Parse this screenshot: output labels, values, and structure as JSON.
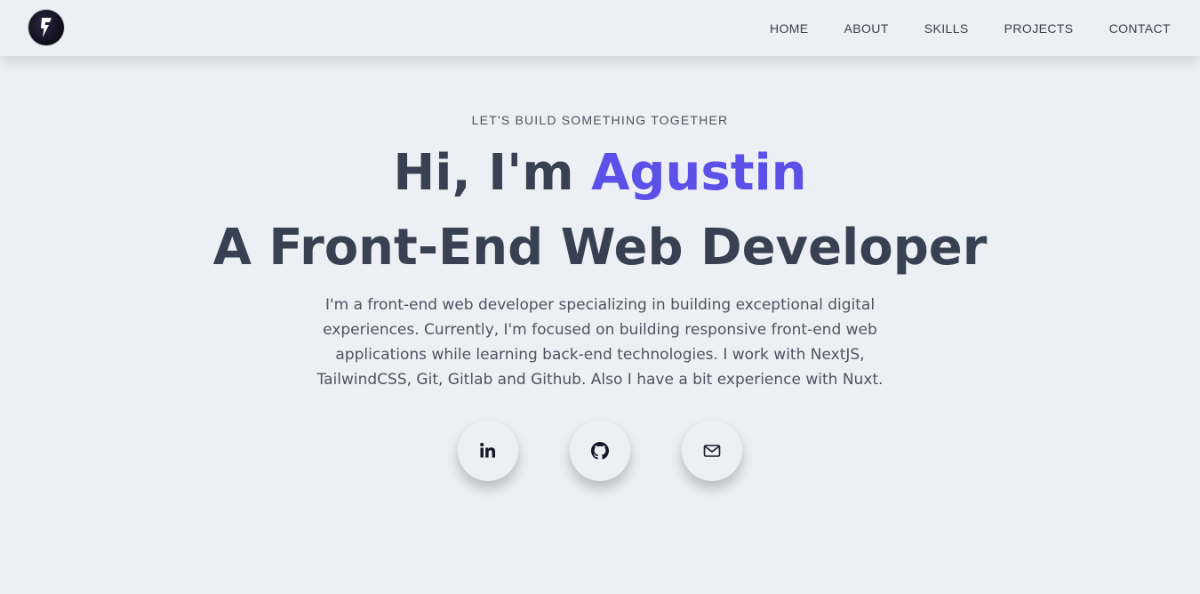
{
  "nav": {
    "logo_icon": "lightning-f-logo-icon",
    "links": [
      {
        "label": "HOME"
      },
      {
        "label": "ABOUT"
      },
      {
        "label": "SKILLS"
      },
      {
        "label": "PROJECTS"
      },
      {
        "label": "CONTACT"
      }
    ]
  },
  "hero": {
    "tagline": "LET'S BUILD SOMETHING TOGETHER",
    "greeting": "Hi, I'm ",
    "name": "Agustin",
    "role": "A Front-End Web Developer",
    "bio": "I'm a front-end web developer specializing in building exceptional digital experiences. Currently, I'm focused on building responsive front-end web applications while learning back-end technologies. I work with NextJS, TailwindCSS, Git, Gitlab and Github. Also I have a bit experience with Nuxt."
  },
  "socials": [
    {
      "icon": "linkedin-icon"
    },
    {
      "icon": "github-icon"
    },
    {
      "icon": "mail-icon"
    }
  ],
  "colors": {
    "background": "#eceff3",
    "accent": "#5b50e8",
    "text": "#374151"
  }
}
